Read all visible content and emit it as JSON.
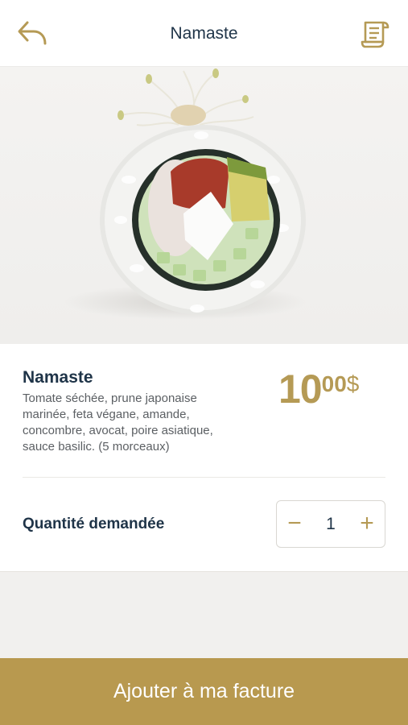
{
  "header": {
    "title": "Namaste",
    "back_icon": "back-arrow-icon",
    "bill_icon": "receipt-icon"
  },
  "product": {
    "name": "Namaste",
    "description": "Tomate séchée, prune japonaise marinée, feta végane, amande, concombre, avocat, poire asiatique, sauce basilic. (5 morceaux)",
    "price": {
      "whole": "10",
      "cents": "00",
      "currency": "$"
    }
  },
  "quantity": {
    "label": "Quantité demandée",
    "value": "1",
    "minus": "−",
    "plus": "+"
  },
  "cta": {
    "label": "Ajouter à ma facture"
  },
  "colors": {
    "accent": "#b8994f",
    "text_dark": "#1f3448",
    "background": "#f1f0ee"
  }
}
